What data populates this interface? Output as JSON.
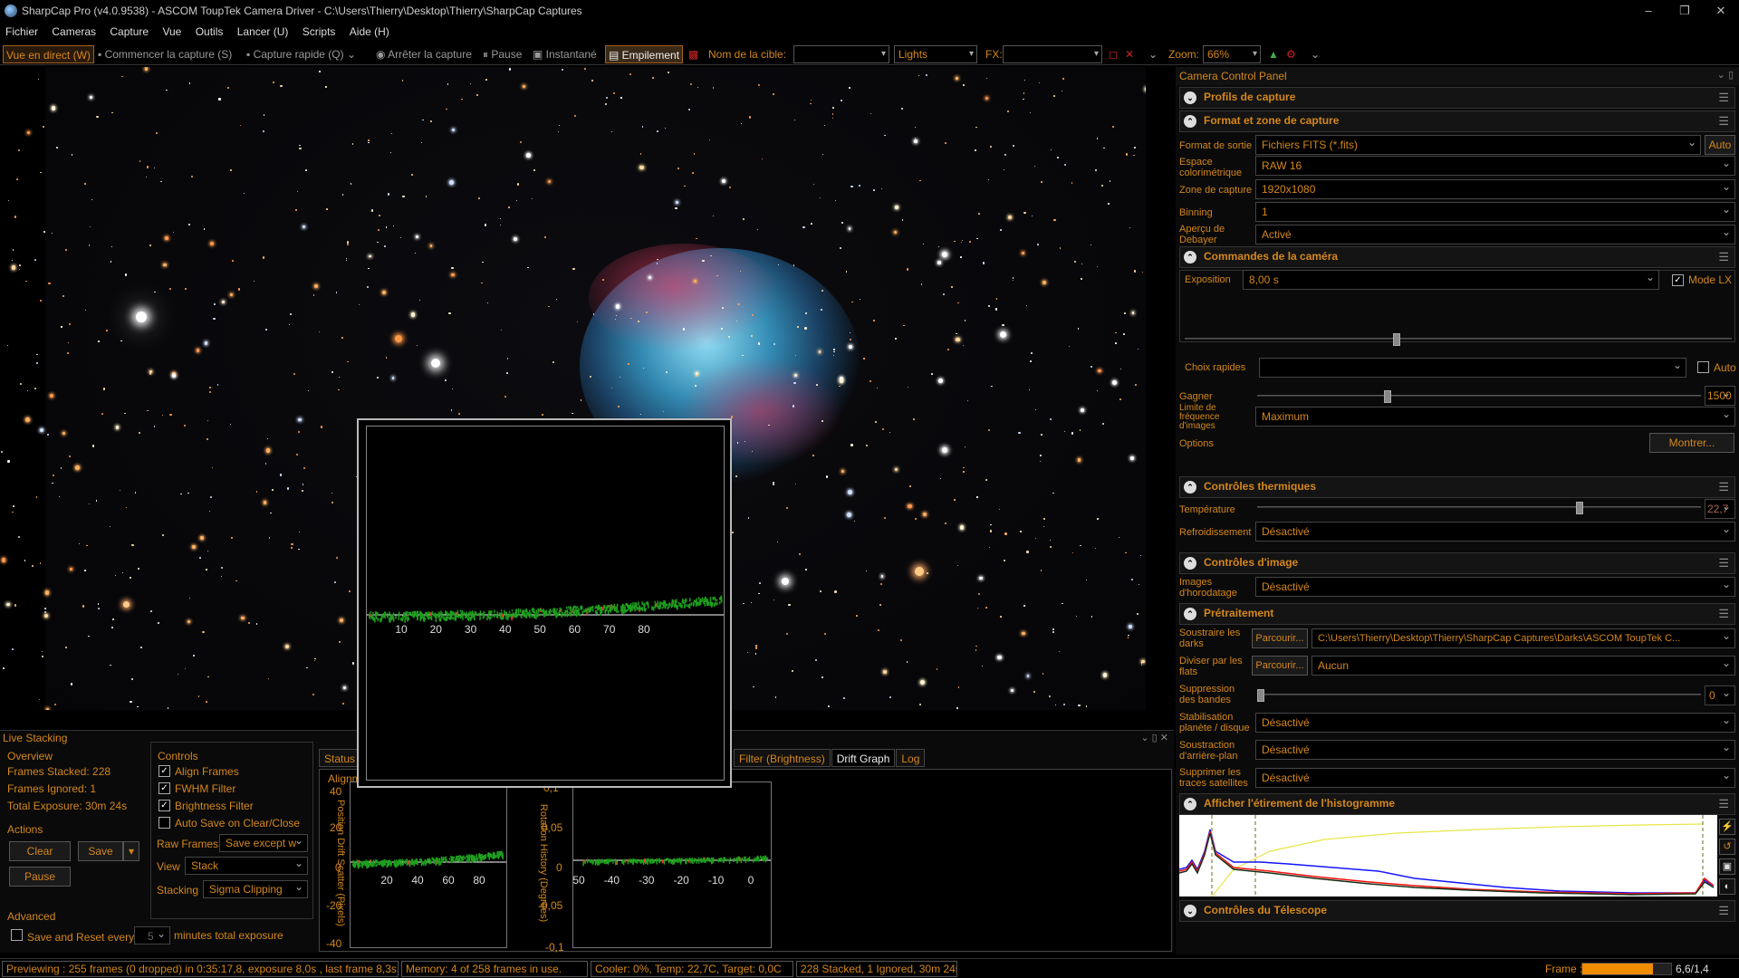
{
  "window": {
    "title": "SharpCap Pro (v4.0.9538) - ASCOM ToupTek Camera Driver - C:\\Users\\Thierry\\Desktop\\Thierry\\SharpCap Captures",
    "min": "–",
    "max": "❐",
    "close": "✕"
  },
  "menu": [
    "Fichier",
    "Cameras",
    "Capture",
    "Vue",
    "Outils",
    "Lancer (U)",
    "Scripts",
    "Aide (H)"
  ],
  "toolbar": {
    "live_view": "Vue en direct (W)",
    "start_capture": "Commencer la capture (S)",
    "quick_capture": "Capture rapide (Q)",
    "stop_capture": "Arrêter la capture",
    "pause": "Pause",
    "snapshot": "Instantané",
    "stacking": "Empilement",
    "target_label": "Nom de la cible:",
    "target_value": "",
    "frame_type": "Lights",
    "fx_label": "FX:",
    "fx_value": "",
    "zoom_label": "Zoom:",
    "zoom_value": "66%"
  },
  "camera_panel": {
    "title": "Camera Control Panel",
    "sections": {
      "profiles": "Profils de capture",
      "format": "Format et zone de capture",
      "camera_controls": "Commandes de la caméra",
      "thermal": "Contrôles thermiques",
      "image": "Contrôles d'image",
      "preprocessing": "Prétraitement",
      "histogram": "Afficher l'étirement de l'histogramme",
      "telescope": "Contrôles du Télescope"
    },
    "format": {
      "output_label": "Format de sortie",
      "output_value": "Fichiers FITS (*.fits)",
      "auto": "Auto",
      "colorspace_label": "Espace colorimétrique",
      "colorspace_value": "RAW 16",
      "area_label": "Zone de capture",
      "area_value": "1920x1080",
      "binning_label": "Binning",
      "binning_value": "1",
      "debayer_label": "Aperçu de Debayer",
      "debayer_value": "Activé"
    },
    "camera": {
      "exposure_label": "Exposition",
      "exposure_value": "8,00 s",
      "lx_mode": "Mode LX",
      "quick_label": "Choix rapides",
      "quick_value": "",
      "auto": "Auto",
      "gain_label": "Gagner",
      "gain_value": "1500",
      "framerate_label": "Limite de fréquence d'images",
      "framerate_value": "Maximum",
      "options_label": "Options",
      "options_button": "Montrer..."
    },
    "thermal": {
      "temp_label": "Température",
      "temp_value": "22,7",
      "cooling_label": "Refroidissement",
      "cooling_value": "Désactivé"
    },
    "image": {
      "timestamp_label": "Images d'horodatage",
      "timestamp_value": "Désactivé"
    },
    "pre": {
      "darks_label": "Soustraire les darks",
      "browse": "Parcourir...",
      "darks_path": "C:\\Users\\Thierry\\Desktop\\Thierry\\SharpCap Captures\\Darks\\ASCOM ToupTek C...",
      "flats_label": "Diviser par les flats",
      "flats_value": "Aucun",
      "banding_label": "Suppression des bandes",
      "banding_value": "0",
      "stab_label": "Stabilisation planète / disque",
      "stab_value": "Désactivé",
      "bg_label": "Soustraction d'arrière-plan",
      "bg_value": "Désactivé",
      "sat_label": "Supprimer les traces satellites",
      "sat_value": "Désactivé"
    }
  },
  "live_stacking": {
    "title": "Live Stacking",
    "overview_title": "Overview",
    "frames_stacked": "Frames Stacked: 228",
    "frames_ignored": "Frames Ignored: 1",
    "total_exposure": "Total Exposure:   30m 24s",
    "actions_title": "Actions",
    "clear": "Clear",
    "save": "Save",
    "pause": "Pause",
    "advanced_title": "Advanced",
    "save_reset": "Save and Reset every",
    "minutes_value": "5",
    "minutes_label": "minutes total exposure",
    "controls_title": "Controls",
    "align": "Align Frames",
    "fwhm": "FWHM Filter",
    "brightness": "Brightness Filter",
    "autosave": "Auto Save on Clear/Close",
    "raw_label": "Raw Frames",
    "raw_value": "Save except w",
    "view_label": "View",
    "view_value": "Stack",
    "stacking_label": "Stacking",
    "stacking_value": "Sigma Clipping",
    "tabs": [
      "Status",
      "Filter (Brightness)",
      "Drift Graph",
      "Log"
    ],
    "align_partial": "Alignm",
    "drift_ylabel": "Position Drift Scatter (Pixels)",
    "rot_ylabel": "Rotation History (Degrees)",
    "drift_yticks": [
      "40",
      "20",
      "0",
      "-20",
      "-40"
    ],
    "drift_xticks": [
      "20",
      "40",
      "60",
      "80"
    ],
    "rot_yticks": [
      "0,1",
      "0,05",
      "0",
      "-0,05",
      "-0,1"
    ],
    "rot_xticks": [
      "-50",
      "-40",
      "-30",
      "-20",
      "-10",
      "0"
    ],
    "popup_xticks": [
      "10",
      "20",
      "30",
      "40",
      "50",
      "60",
      "70",
      "80"
    ]
  },
  "status": {
    "preview": "Previewing : 255 frames (0 dropped) in 0:35:17,8, exposure 8,0s , last frame 8,3s",
    "memory": "Memory: 4 of 258 frames in use.",
    "cooler": "Cooler: 0%, Temp: 22,7C, Target: 0,0C",
    "stacked": "228 Stacked, 1 Ignored, 30m 24s",
    "frame_label": "Frame :",
    "frame_value": "6,6/1,4",
    "frame_progress": 0.8
  },
  "colors": {
    "accent": "#d4871a",
    "bg": "#000000",
    "panel": "#0a0a0a"
  }
}
